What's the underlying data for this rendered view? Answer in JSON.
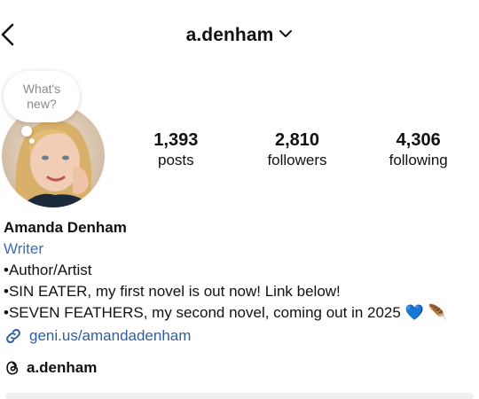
{
  "header": {
    "username": "a.denham"
  },
  "note": {
    "text": "What's new?"
  },
  "stats": [
    {
      "value": "1,393",
      "label": "posts"
    },
    {
      "value": "2,810",
      "label": "followers"
    },
    {
      "value": "4,306",
      "label": "following"
    }
  ],
  "bio": {
    "name": "Amanda Denham",
    "category": "Writer",
    "lines": [
      "•Author/Artist",
      "•SIN EATER, my first novel is out now! Link below!",
      "•SEVEN FEATHERS, my second novel, coming out in 2025 💙 🪶"
    ],
    "highlight_color": "#ff8cff"
  },
  "link": {
    "text": "geni.us/amandadenham",
    "color": "#2f5fa0"
  },
  "threads": {
    "handle": "a.denham"
  },
  "icons": {
    "back": "chevron-left-icon",
    "username_dropdown": "chevron-down-icon",
    "link": "link-icon",
    "threads": "threads-icon"
  }
}
